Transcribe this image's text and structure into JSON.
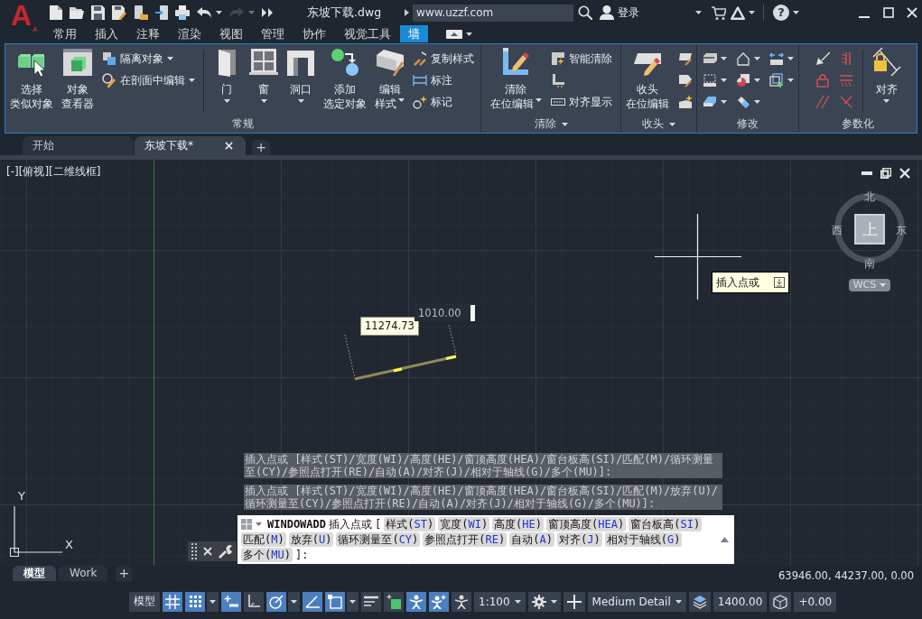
{
  "app_logo": {
    "letter": "A",
    "badge": "A"
  },
  "title_bar": {
    "quick_access": [
      {
        "dropdown": false,
        "disabled": false
      },
      {
        "dropdown": false,
        "disabled": false
      },
      {
        "dropdown": false,
        "disabled": false
      },
      {
        "dropdown": false,
        "disabled": false
      },
      {
        "dropdown": false,
        "disabled": false
      },
      {
        "dropdown": false,
        "disabled": false
      },
      {
        "dropdown": false,
        "disabled": false
      },
      {
        "dropdown": true,
        "disabled": false
      },
      {
        "dropdown": true,
        "disabled": true
      },
      {
        "dropdown": false,
        "disabled": false
      }
    ],
    "title": "东坡下载.dwg",
    "search": {
      "value": "www.uzzf.com"
    },
    "sign_in": "登录",
    "help": "?"
  },
  "ribbon_tabs": [
    {
      "label": "常用",
      "selected": false
    },
    {
      "label": "插入",
      "selected": false
    },
    {
      "label": "注释",
      "selected": false
    },
    {
      "label": "渲染",
      "selected": false
    },
    {
      "label": "视图",
      "selected": false
    },
    {
      "label": "管理",
      "selected": false
    },
    {
      "label": "协作",
      "selected": false
    },
    {
      "label": "视觉工具",
      "selected": false
    },
    {
      "label": "墙",
      "selected": true
    }
  ],
  "ribbon_panels": [
    {
      "title": "常规",
      "dropdown": false,
      "columns": [
        {
          "kind": "large",
          "lines": [
            "选择",
            "类似对象"
          ],
          "dropdown": false
        },
        {
          "kind": "large",
          "lines": [
            "对象",
            "查看器"
          ],
          "dropdown": false
        },
        {
          "kind": "stack",
          "items": [
            {
              "label": "隔离对象",
              "dropdown": true
            },
            {
              "label": "在剖面中编辑",
              "dropdown": true
            }
          ]
        },
        {
          "kind": "separator"
        },
        {
          "kind": "large",
          "lines": [
            "门"
          ],
          "dropdown": true
        },
        {
          "kind": "large",
          "lines": [
            "窗"
          ],
          "dropdown": true
        },
        {
          "kind": "large",
          "lines": [
            "洞口"
          ],
          "dropdown": true
        },
        {
          "kind": "large",
          "lines": [
            "添加",
            "选定对象"
          ],
          "dropdown": false
        },
        {
          "kind": "large",
          "lines": [
            "编辑",
            "样式"
          ],
          "dropdown": true
        },
        {
          "kind": "stack",
          "items": [
            {
              "label": "复制样式",
              "dropdown": false
            },
            {
              "label": "标注",
              "dropdown": false
            },
            {
              "label": "标记",
              "dropdown": false
            }
          ]
        }
      ]
    },
    {
      "title": "清除",
      "dropdown": true,
      "columns": [
        {
          "kind": "large",
          "lines": [
            "清除",
            "在位编辑"
          ],
          "dropdown": true
        },
        {
          "kind": "stack",
          "items": [
            {
              "label": "智能清除",
              "dropdown": false
            },
            {
              "dropdown": false
            },
            {
              "label": "对齐显示",
              "dropdown": false
            }
          ]
        }
      ]
    },
    {
      "title": "收头",
      "dropdown": true,
      "columns": [
        {
          "kind": "large",
          "lines": [
            "收头",
            "在位编辑"
          ],
          "dropdown": false
        },
        {
          "kind": "stack",
          "items": [
            {
              "dropdown": false
            },
            {
              "dropdown": false
            },
            {
              "dropdown": false
            }
          ]
        }
      ]
    },
    {
      "title": "修改",
      "dropdown": false,
      "columns": [
        {
          "kind": "stack",
          "items": [
            {
              "dropdown": true
            },
            {
              "dropdown": true
            },
            {
              "dropdown": true
            }
          ]
        },
        {
          "kind": "stack",
          "items": [
            {
              "dropdown": true
            },
            {
              "dropdown": true
            },
            {
              "dropdown": true
            }
          ]
        },
        {
          "kind": "stack",
          "items": [
            {
              "dropdown": true
            },
            {
              "dropdown": true
            }
          ]
        }
      ]
    },
    {
      "title": "参数化",
      "dropdown": false,
      "columns": [
        {
          "kind": "stack",
          "items": [
            {
              "dropdown": false
            },
            {
              "dropdown": false
            },
            {
              "dropdown": false
            }
          ]
        },
        {
          "kind": "stack",
          "items": [
            {
              "dropdown": false
            },
            {
              "dropdown": false
            },
            {
              "dropdown": false
            }
          ]
        },
        {
          "kind": "separator"
        },
        {
          "kind": "large",
          "lines": [
            "对齐"
          ],
          "dropdown": true
        }
      ]
    }
  ],
  "document_tabs": [
    {
      "label": "开始",
      "selected": false,
      "closable": false
    },
    {
      "label": "东坡下载*",
      "selected": true,
      "closable": true
    }
  ],
  "new_document_tab": "+",
  "viewport": {
    "label": "[-][俯视][二维线框]",
    "viewcube": {
      "north": "北",
      "south": "南",
      "west": "西",
      "east": "东",
      "face": "上",
      "coordinate_system": "WCS"
    },
    "cursor_tooltip": "插入点或",
    "dimension_value": "11274.73",
    "length_input": "1010.00",
    "ucs_axes": {
      "y": "Y",
      "x": "X"
    }
  },
  "command_history": [
    "插入点或 [样式(ST)/宽度(WI)/高度(HE)/窗顶高度(HEA)/窗台板高(SI)/匹配(M)/循环测量至(CY)/参照点打开(RE)/自动(A)/对齐(J)/相对于轴线(G)/多个(MU)]:",
    "插入点或 [样式(ST)/宽度(WI)/高度(HE)/窗顶高度(HEA)/窗台板高(SI)/匹配(M)/放弃(U)/循环测量至(CY)/参照点打开(RE)/自动(A)/对齐(J)/相对于轴线(G)/多个(MU)]:"
  ],
  "command_line": {
    "command": "WINDOWADD",
    "prompt": "插入点或",
    "open": "[",
    "options": [
      {
        "label": "样式(",
        "key": "ST",
        "close": ")"
      },
      {
        "label": "宽度(",
        "key": "WI",
        "close": ")"
      },
      {
        "label": "高度(",
        "key": "HE",
        "close": ")"
      },
      {
        "label": "窗顶高度(",
        "key": "HEA",
        "close": ")"
      },
      {
        "label": "窗台板高(",
        "key": "SI",
        "close": ")"
      },
      {
        "label": "匹配(",
        "key": "M",
        "close": ")"
      },
      {
        "label": "放弃(",
        "key": "U",
        "close": ")"
      },
      {
        "label": "循环测量至(",
        "key": "CY",
        "close": ")"
      },
      {
        "label": "参照点打开(",
        "key": "RE",
        "close": ")"
      },
      {
        "label": "自动(",
        "key": "A",
        "close": ")"
      },
      {
        "label": "对齐(",
        "key": "J",
        "close": ")"
      },
      {
        "label": "相对于轴线(",
        "key": "G",
        "close": ")"
      },
      {
        "label": "多个(",
        "key": "MU",
        "close": ")"
      }
    ],
    "end": "]:"
  },
  "layout_tabs": [
    {
      "label": "模型",
      "selected": true
    },
    {
      "label": "Work",
      "selected": false
    }
  ],
  "new_layout_tab": "+",
  "coordinates": "63946.00, 44237.00, 0.00",
  "status_bar": [
    {
      "kind": "text",
      "text": "模型"
    },
    {
      "kind": "toggle",
      "on": true,
      "dropdown": false
    },
    {
      "kind": "toggle",
      "on": true,
      "dropdown": true
    },
    {
      "kind": "toggle",
      "on": true,
      "dropdown": false
    },
    {
      "kind": "toggle",
      "on": false,
      "dropdown": false
    },
    {
      "kind": "toggle",
      "on": true,
      "dropdown": true
    },
    {
      "kind": "toggle",
      "on": true,
      "dropdown": false
    },
    {
      "kind": "toggle",
      "on": true,
      "dropdown": true
    },
    {
      "kind": "toggle",
      "on": false,
      "dropdown": false
    },
    {
      "kind": "toggle",
      "on": false,
      "dropdown": false
    },
    {
      "kind": "toggle",
      "on": true,
      "dropdown": false
    },
    {
      "kind": "toggle",
      "on": true,
      "dropdown": false
    },
    {
      "kind": "toggle",
      "on": false,
      "dropdown": false
    },
    {
      "kind": "menu",
      "text": "1:100",
      "dropdown": true
    },
    {
      "kind": "tool",
      "dropdown": true
    },
    {
      "kind": "tool",
      "dropdown": false
    },
    {
      "kind": "menu",
      "text": "Medium Detail",
      "dropdown": true
    },
    {
      "kind": "tool",
      "dropdown": false
    },
    {
      "kind": "text",
      "text": "1400.00"
    },
    {
      "kind": "tool",
      "dropdown": false
    },
    {
      "kind": "text",
      "text": "+0.00"
    }
  ]
}
